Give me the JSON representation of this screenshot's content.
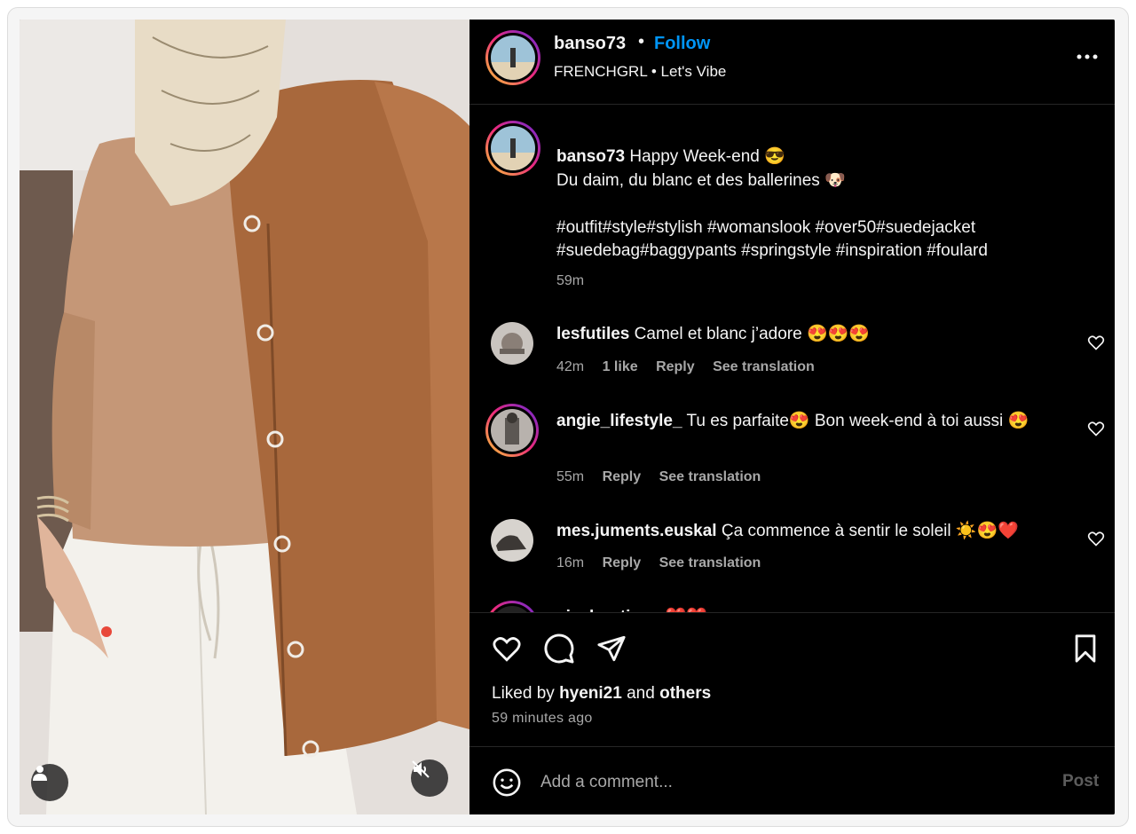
{
  "header": {
    "username": "banso73",
    "follow_label": "Follow",
    "separator": "•",
    "audio": "FRENCHGRL • Let's Vibe"
  },
  "caption": {
    "username": "banso73",
    "line1": "Happy Week-end 😎",
    "line2": "Du daim, du blanc et des ballerines 🐶",
    "hashtags1": "#outfit#style#stylish #womanslook #over50#suedejacket",
    "hashtags2": "#suedebag#baggypants #springstyle #inspiration #foulard",
    "time": "59m"
  },
  "comments": [
    {
      "username": "lesfutiles",
      "text": "Camel et blanc j’adore 😍😍😍",
      "time": "42m",
      "likes": "1 like",
      "reply": "Reply",
      "translate": "See translation"
    },
    {
      "username": "angie_lifestyle_",
      "text": "Tu es parfaite😍 Bon week-end à toi aussi 😍",
      "time": "55m",
      "reply": "Reply",
      "translate": "See translation"
    },
    {
      "username": "mes.juments.euskal",
      "text": "Ça commence à sentir le soleil ☀️😍❤️",
      "time": "16m",
      "reply": "Reply",
      "translate": "See translation"
    },
    {
      "username": "aie_boutique",
      "text": "❤️❤️"
    }
  ],
  "actions": {
    "liked_prefix": "Liked by",
    "liked_user": "hyeni21",
    "liked_and": "and",
    "liked_others": "others",
    "time_ago": "59 minutes ago"
  },
  "add_comment": {
    "placeholder": "Add a comment...",
    "post_label": "Post"
  },
  "icons": {
    "more": "more-options-icon",
    "heart": "heart-icon",
    "comment": "comment-icon",
    "share": "share-icon",
    "save": "bookmark-icon",
    "emoji": "emoji-icon",
    "user_tag": "user-tag-icon",
    "mute": "speaker-muted-icon"
  },
  "colors": {
    "background": "#000000",
    "link_blue": "#0095f6",
    "muted_text": "#a8a8a8"
  }
}
